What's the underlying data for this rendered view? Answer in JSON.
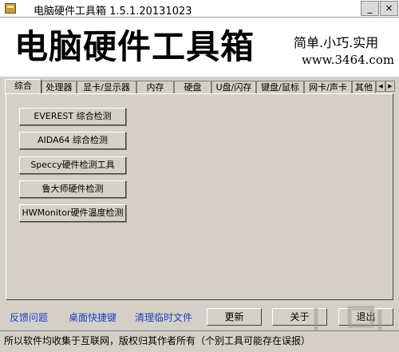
{
  "window": {
    "title": "电脑硬件工具箱 1.5.1.20131023",
    "minimize_label": "_",
    "close_label": "×"
  },
  "banner": {
    "title": "电脑硬件工具箱",
    "slogan": "简单.小巧.实用",
    "url": "www.3464.com"
  },
  "tabs": [
    {
      "label": "综合",
      "active": true
    },
    {
      "label": "处理器"
    },
    {
      "label": "显卡/显示器"
    },
    {
      "label": "内存"
    },
    {
      "label": "硬盘"
    },
    {
      "label": "U盘/闪存"
    },
    {
      "label": "键盘/鼠标"
    },
    {
      "label": "网卡/声卡"
    },
    {
      "label": "其他"
    }
  ],
  "tab_scroll": {
    "left": "◀",
    "right": "▶"
  },
  "tools": [
    "EVEREST 综合检测",
    "AIDA64  综合检测",
    "Speccy硬件检测工具",
    "鲁大师硬件检测",
    "HWMonitor硬件温度检测"
  ],
  "footer": {
    "links": [
      "反馈问题",
      "桌面快捷键",
      "清理临时文件"
    ],
    "buttons": [
      "更新",
      "关于",
      "退出"
    ]
  },
  "status": {
    "text": "所以软件均收集于互联网，版权归其作者所有（个别工具可能存在误报）"
  }
}
